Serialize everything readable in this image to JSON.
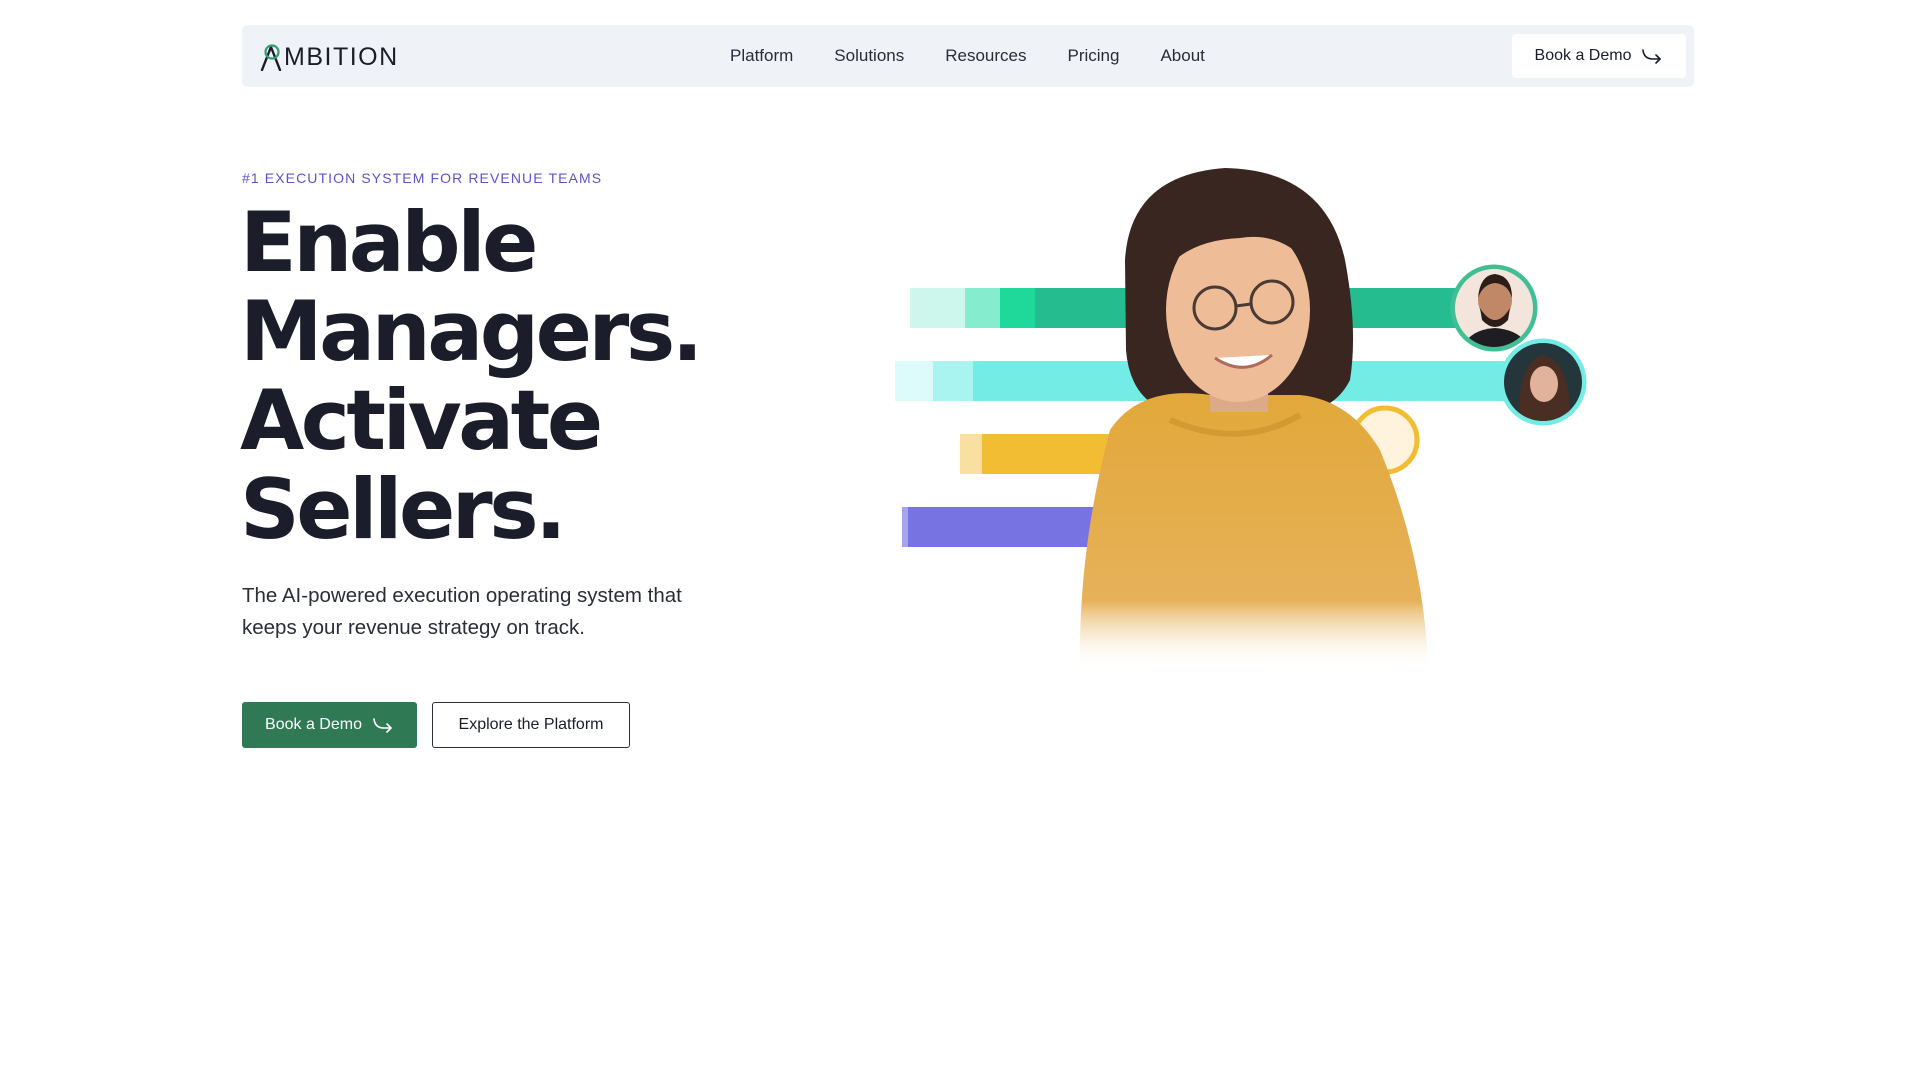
{
  "nav": {
    "logo_text": "MBITION",
    "links": [
      "Platform",
      "Solutions",
      "Resources",
      "Pricing",
      "About"
    ],
    "cta_label": "Book a Demo"
  },
  "hero": {
    "eyebrow": "#1 EXECUTION SYSTEM FOR REVENUE TEAMS",
    "headline_lines": [
      "Enable",
      "Managers.",
      "Activate",
      "Sellers."
    ],
    "subtext": "The AI-powered execution operating system that keeps your revenue strategy on track.",
    "primary_button": "Book a Demo",
    "secondary_button": "Explore the Platform"
  },
  "colors": {
    "brand_green": "#2f7a55",
    "accent_purple": "#5b54c8",
    "bar_green": "#1fbf8f",
    "bar_cyan": "#6fe9e2",
    "bar_yellow": "#f2bd32",
    "bar_purple": "#7873e2"
  },
  "icons": {
    "logo": "ambition-logo-icon",
    "arrow": "curved-arrow-right-icon"
  }
}
